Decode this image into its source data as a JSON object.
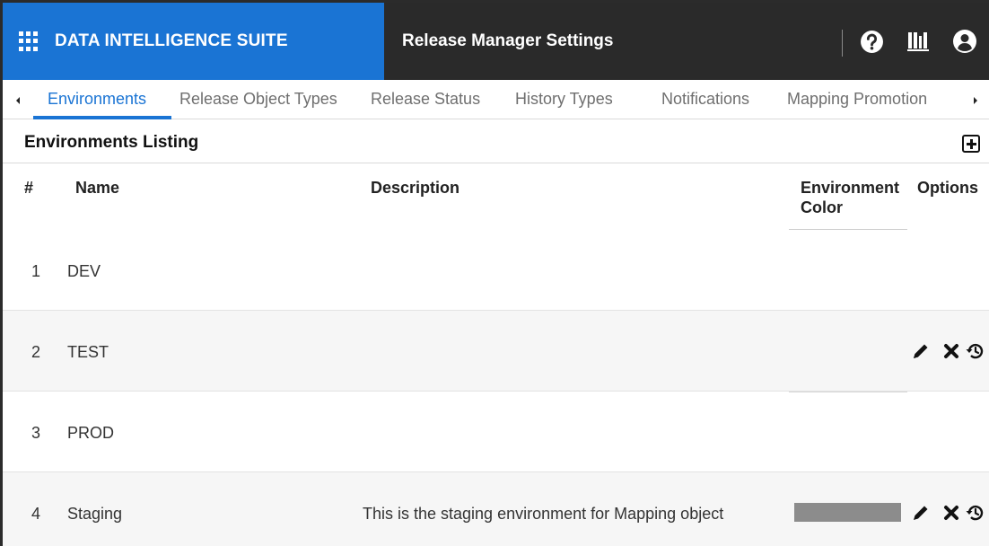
{
  "header": {
    "brand_title": "DATA INTELLIGENCE SUITE",
    "page_title": "Release Manager Settings",
    "colors": {
      "brand_blue": "#1a74d4",
      "dark_bar": "#2a2a2a"
    },
    "icons": [
      "help-icon",
      "library-icon",
      "user-icon"
    ]
  },
  "tabs": [
    {
      "label": "Environments",
      "active": true
    },
    {
      "label": "Release Object Types",
      "active": false
    },
    {
      "label": "Release Status",
      "active": false
    },
    {
      "label": "History Types",
      "active": false
    },
    {
      "label": "Notifications",
      "active": false
    },
    {
      "label": "Mapping Promotion",
      "active": false
    }
  ],
  "section": {
    "title": "Environments Listing"
  },
  "table": {
    "columns": {
      "num": "#",
      "name": "Name",
      "description": "Description",
      "env_color": "Environment Color",
      "options": "Options"
    },
    "rows": [
      {
        "num": "1",
        "name": "DEV",
        "description": "",
        "color": "",
        "options": []
      },
      {
        "num": "2",
        "name": "TEST",
        "description": "",
        "color": "",
        "options": [
          "edit-icon",
          "delete-icon",
          "history-icon"
        ]
      },
      {
        "num": "3",
        "name": "PROD",
        "description": "",
        "color": "",
        "options": []
      },
      {
        "num": "4",
        "name": "Staging",
        "description": "This is the staging environment for Mapping object",
        "color": "#8c8c8c",
        "options": [
          "edit-icon",
          "delete-icon",
          "history-icon"
        ]
      }
    ]
  }
}
